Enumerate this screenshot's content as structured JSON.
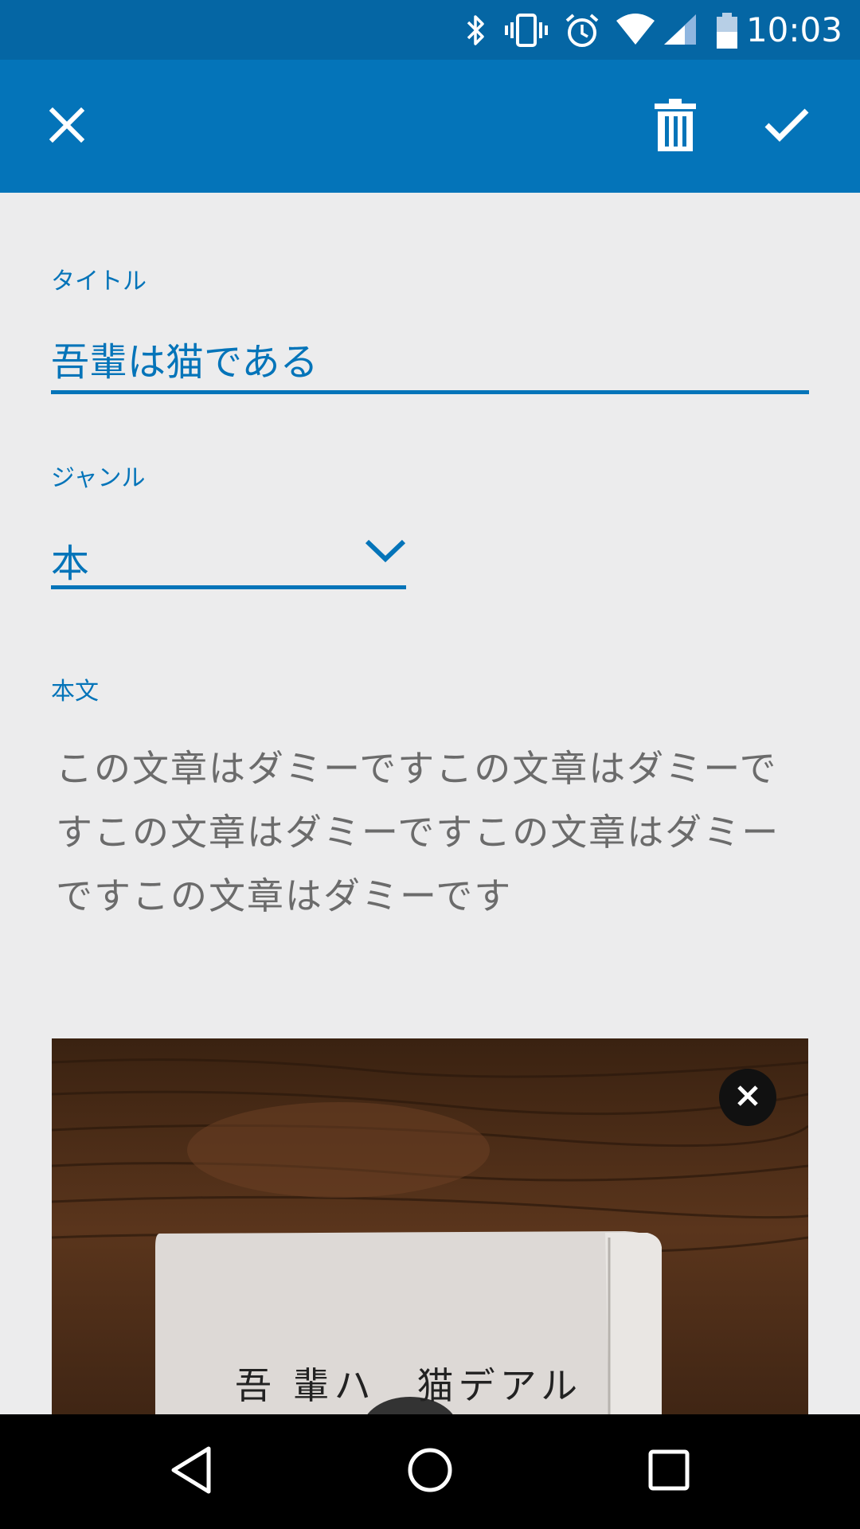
{
  "status_bar": {
    "time": "10:03",
    "icons": [
      "bluetooth-icon",
      "vibrate-icon",
      "alarm-icon",
      "wifi-icon",
      "cell-signal-icon",
      "battery-icon"
    ]
  },
  "app_bar": {
    "close_icon": "close-icon",
    "delete_icon": "trash-icon",
    "save_icon": "check-icon"
  },
  "form": {
    "title": {
      "label": "タイトル",
      "value": "吾輩は猫である"
    },
    "genre": {
      "label": "ジャンル",
      "selected": "本"
    },
    "body": {
      "label": "本文",
      "value": "この文章はダミーですこの文章はダミーですこの文章はダミーですこの文章はダミーですこの文章はダミーです"
    },
    "image": {
      "book_cover_text": "吾 輩ハ　猫デアル",
      "remove_icon": "close-icon"
    }
  },
  "nav_bar": {
    "icons": [
      "back-icon",
      "home-icon",
      "recents-icon"
    ]
  },
  "colors": {
    "status_bar": "#0566a4",
    "app_bar": "#0474b9",
    "accent": "#0474b9",
    "background": "#ececed",
    "body_text": "#6b6b6b"
  }
}
